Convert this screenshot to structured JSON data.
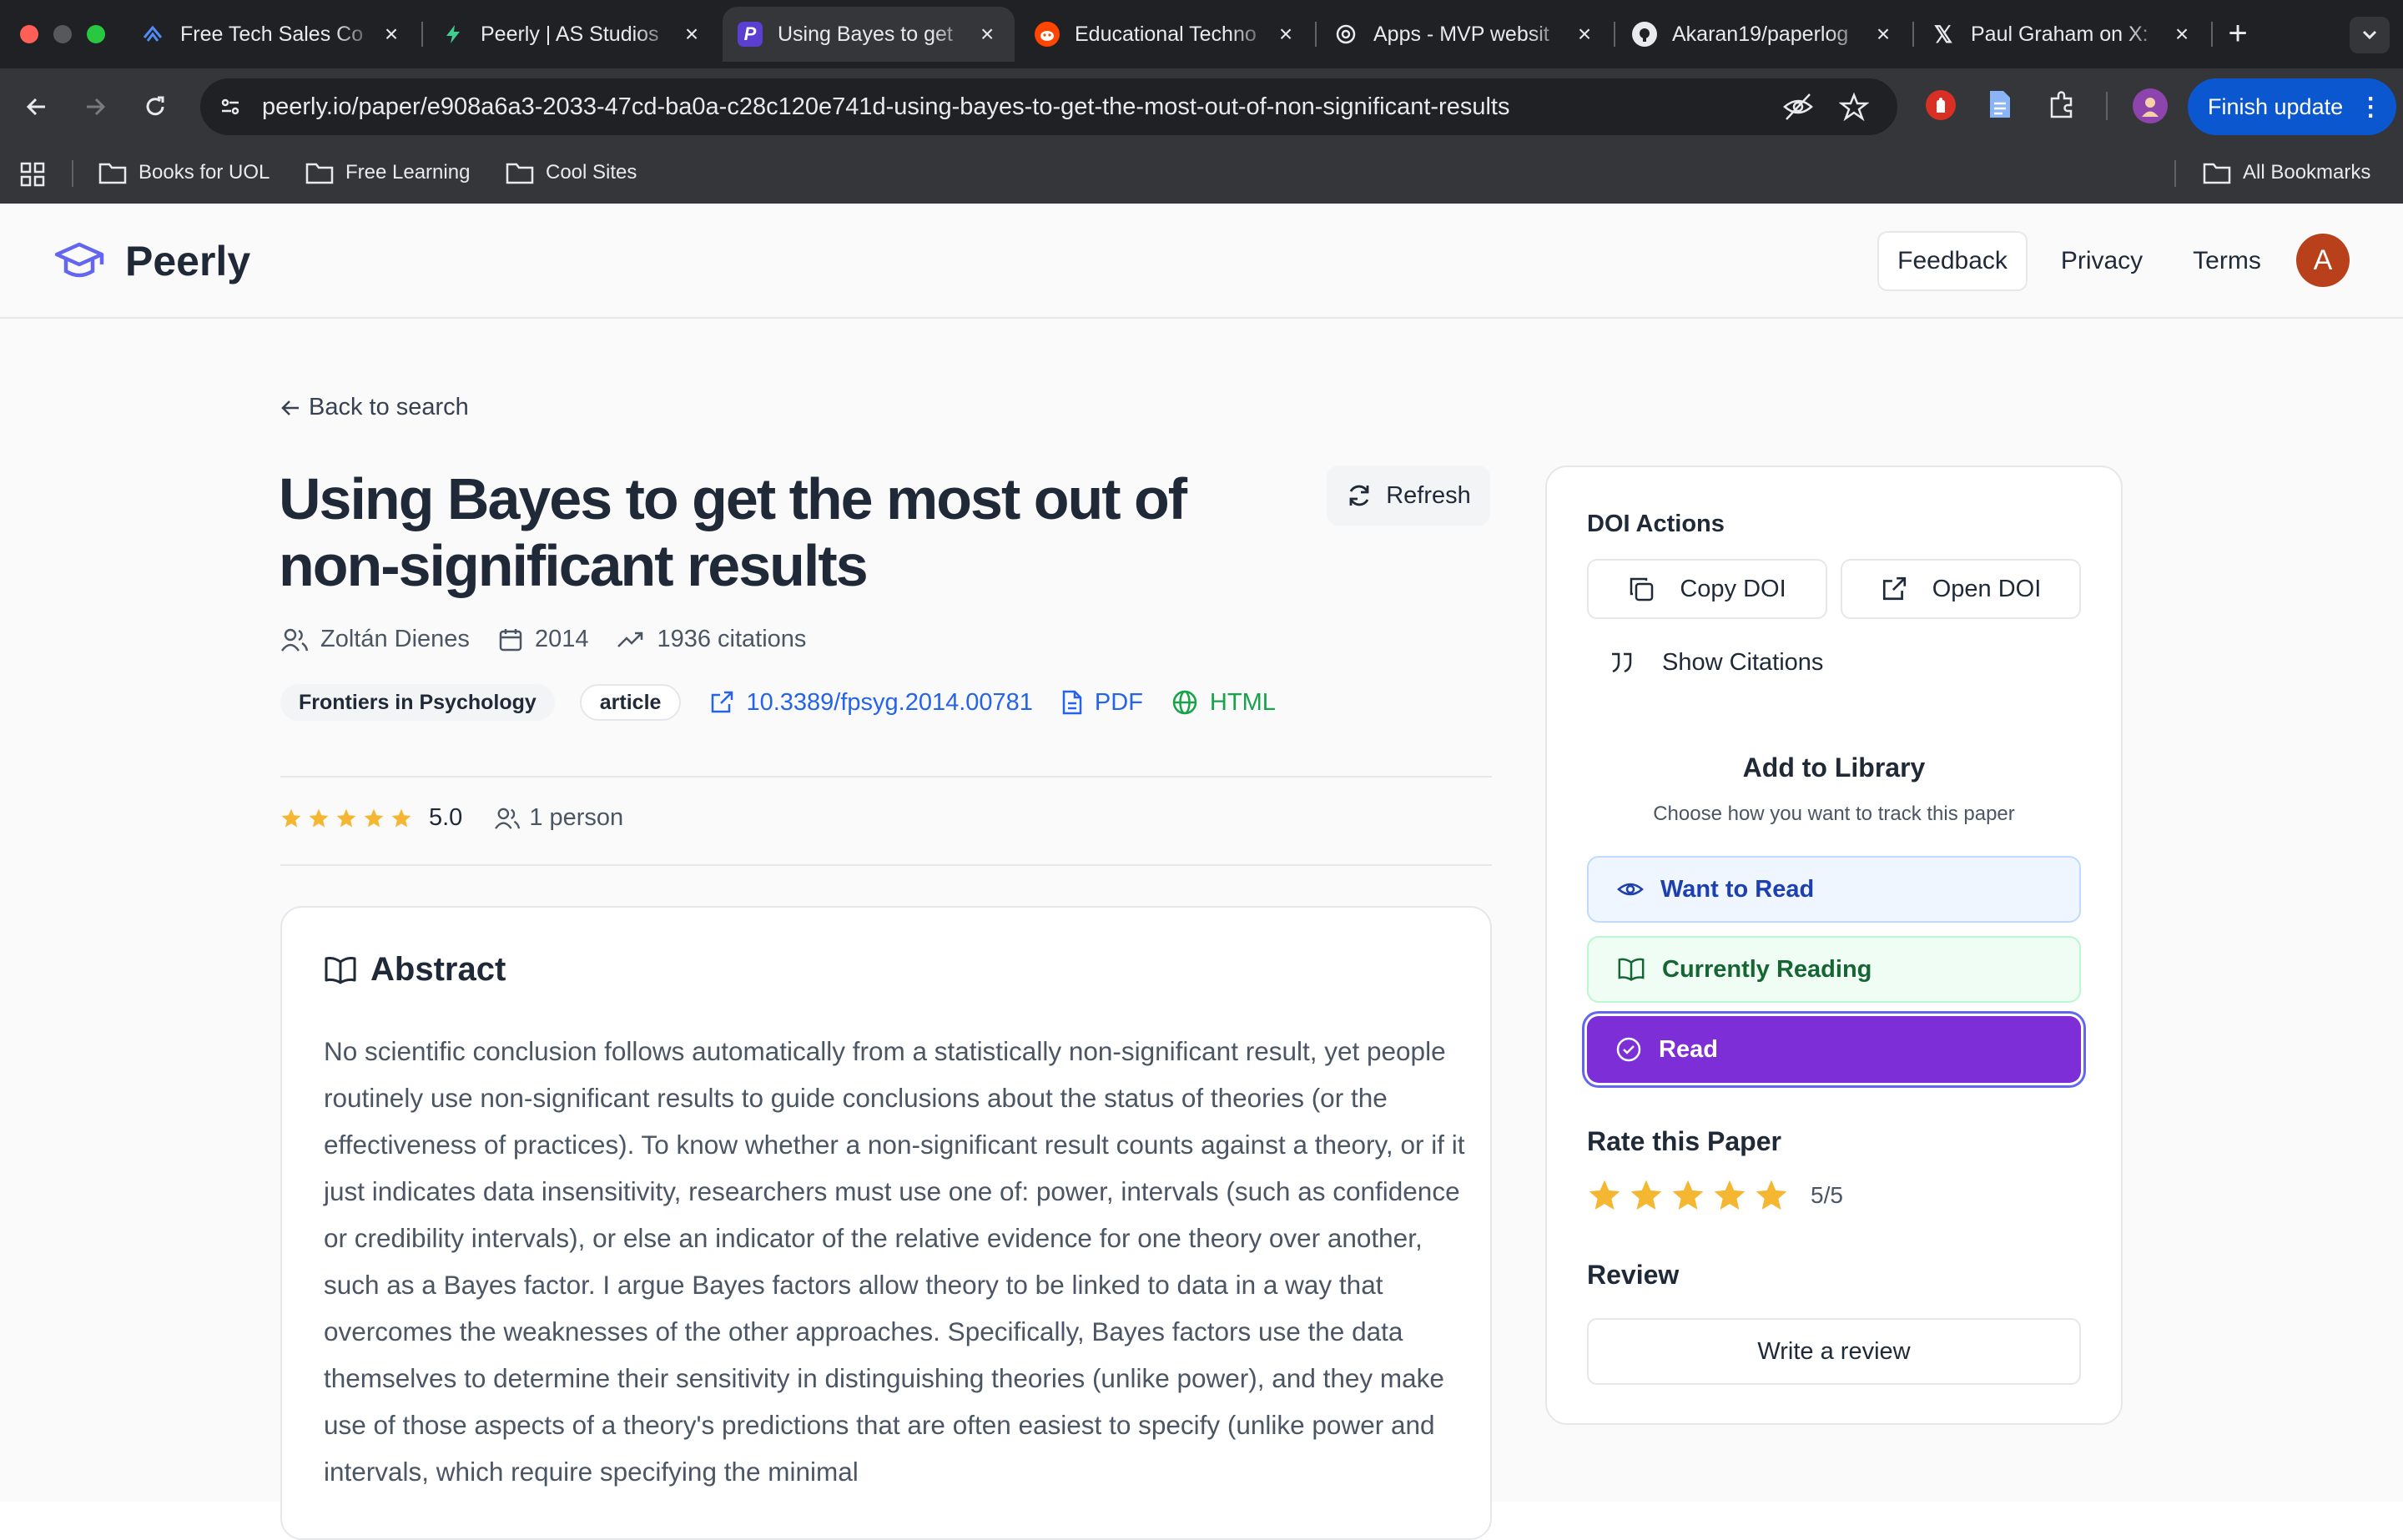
{
  "browser": {
    "tabs": [
      {
        "title": "Free Tech Sales Co",
        "icon": "caret-logo-icon"
      },
      {
        "title": "Peerly | AS Studios",
        "icon": "bolt-icon"
      },
      {
        "title": "Using Bayes to get",
        "icon": "peerly-p-icon"
      },
      {
        "title": "Educational Techno",
        "icon": "reddit-icon"
      },
      {
        "title": "Apps - MVP websit",
        "icon": "openai-icon"
      },
      {
        "title": "Akaran19/paperlog",
        "icon": "github-icon"
      },
      {
        "title": "Paul Graham on X:",
        "icon": "x-icon"
      }
    ],
    "url": "peerly.io/paper/e908a6a3-2033-47cd-ba0a-c28c120e741d-using-bayes-to-get-the-most-out-of-non-significant-results",
    "finish_update": "Finish update",
    "bookmarks": [
      "Books for UOL",
      "Free Learning",
      "Cool Sites"
    ],
    "all_bookmarks": "All Bookmarks"
  },
  "header": {
    "brand": "Peerly",
    "feedback": "Feedback",
    "privacy": "Privacy",
    "terms": "Terms",
    "avatar_initial": "A",
    "accent": "#6366f1"
  },
  "paper": {
    "back": "Back to search",
    "title": "Using Bayes to get the most out of non-significant results",
    "refresh": "Refresh",
    "author": "Zoltán Dienes",
    "year": "2014",
    "citations": "1936 citations",
    "journal": "Frontiers in Psychology",
    "type": "article",
    "doi": "10.3389/fpsyg.2014.00781",
    "pdf": "PDF",
    "html": "HTML",
    "rating_value": "5.0",
    "rating_stars": 5,
    "raters": "1 person"
  },
  "abstract": {
    "heading": "Abstract",
    "text": "No scientific conclusion follows automatically from a statistically non-significant result, yet people routinely use non-significant results to guide conclusions about the status of theories (or the effectiveness of practices). To know whether a non-significant result counts against a theory, or if it just indicates data insensitivity, researchers must use one of: power, intervals (such as confidence or credibility intervals), or else an indicator of the relative evidence for one theory over another, such as a Bayes factor. I argue Bayes factors allow theory to be linked to data in a way that overcomes the weaknesses of the other approaches. Specifically, Bayes factors use the data themselves to determine their sensitivity in distinguishing theories (unlike power), and they make use of those aspects of a theory's predictions that are often easiest to specify (unlike power and intervals, which require specifying the minimal"
  },
  "sidebar": {
    "doi_actions": "DOI Actions",
    "copy_doi": "Copy DOI",
    "open_doi": "Open DOI",
    "show_citations": "Show Citations",
    "library_title": "Add to Library",
    "library_sub": "Choose how you want to track this paper",
    "want_to_read": "Want to Read",
    "currently_reading": "Currently Reading",
    "read": "Read",
    "rate_title": "Rate this Paper",
    "my_rating": 5,
    "rate_value": "5/5",
    "review_title": "Review",
    "write_review": "Write a review",
    "colors": {
      "want": "#1e40af",
      "reading": "#166534",
      "read": "#7e2ed6",
      "star": "#f5b731"
    }
  }
}
